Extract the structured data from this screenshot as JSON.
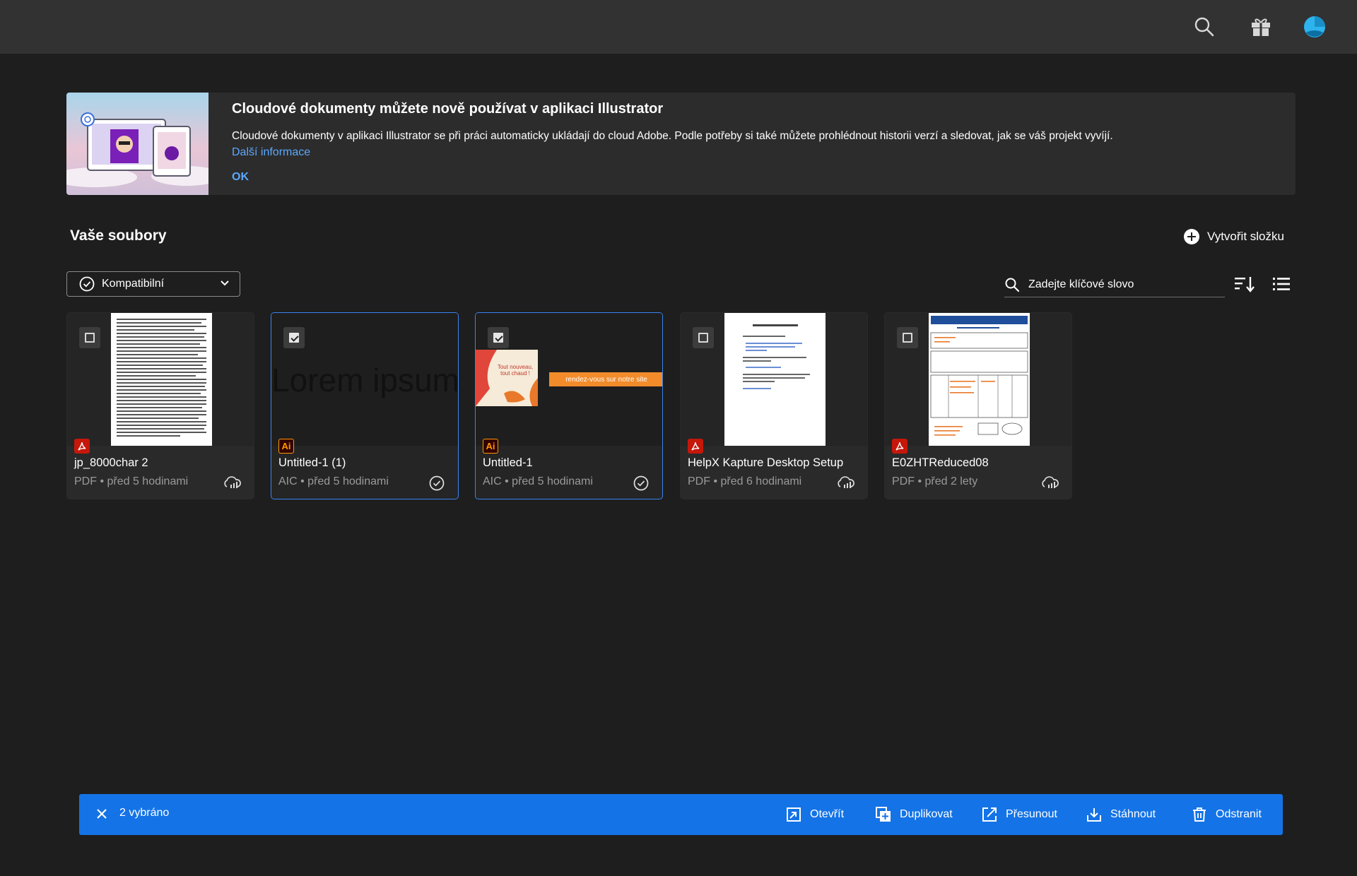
{
  "banner": {
    "title": "Cloudové dokumenty můžete nově používat v aplikaci Illustrator",
    "body": "Cloudové dokumenty v aplikaci Illustrator se při práci automaticky ukládají do cloud Adobe. Podle potřeby si také můžete prohlédnout historii verzí a sledovat, jak se váš projekt vyvíjí.",
    "link": "Další informace",
    "ok": "OK"
  },
  "section": {
    "title": "Vaše soubory",
    "create_folder": "Vytvořit složku"
  },
  "filter": {
    "selected": "Kompatibilní"
  },
  "search": {
    "placeholder": "Zadejte klíčové slovo"
  },
  "files": [
    {
      "name": "jp_8000char 2",
      "meta": "PDF • před 5 hodinami",
      "type": "PDF",
      "selected": false,
      "status": "cloud-icon"
    },
    {
      "name": "Untitled-1 (1)",
      "meta": "AIC • před 5 hodinami",
      "type": "Ai",
      "selected": true,
      "status": "synced-check-icon",
      "thumb_text": "Lorem ipsum"
    },
    {
      "name": "Untitled-1",
      "meta": "AIC • před 5 hodinami",
      "type": "Ai",
      "selected": true,
      "status": "synced-check-icon",
      "thumb_text_1": "Tout nouveau, tout chaud !",
      "thumb_text_2": "rendez-vous sur notre site"
    },
    {
      "name": "HelpX Kapture Desktop Setup",
      "meta": "PDF • před 6 hodinami",
      "type": "PDF",
      "selected": false,
      "status": "cloud-icon"
    },
    {
      "name": "E0ZHTReduced08",
      "meta": "PDF • před 2 lety",
      "type": "PDF",
      "selected": false,
      "status": "cloud-icon"
    }
  ],
  "actionbar": {
    "count": "2 vybráno",
    "open": "Otevřít",
    "duplicate": "Duplikovat",
    "move": "Přesunout",
    "download": "Stáhnout",
    "delete": "Odstranit"
  },
  "colors": {
    "accent": "#1473e6",
    "link": "#5ba8ff",
    "background": "#1e1e1e"
  }
}
